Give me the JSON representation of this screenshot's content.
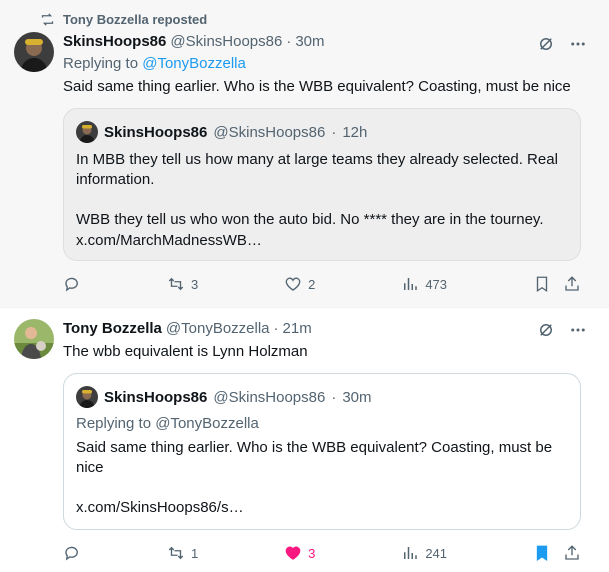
{
  "tweet1": {
    "repost_label": "Tony Bozzella reposted",
    "author_name": "SkinsHoops86",
    "author_handle": "@SkinsHoops86",
    "dot": "·",
    "time": "30m",
    "replying_prefix": "Replying to",
    "replying_mention": "@TonyBozzella",
    "text": "Said same thing earlier. Who is the WBB equivalent? Coasting, must be nice",
    "quote": {
      "author_name": "SkinsHoops86",
      "author_handle": "@SkinsHoops86",
      "dot": "·",
      "time": "12h",
      "text_line1": "In MBB they tell us how many at large teams they already selected. Real information.",
      "text_line2": "WBB they tell us who won the auto bid. No **** they are in the tourney.",
      "link": "x.com/MarchMadnessWB…"
    },
    "actions": {
      "reposts": "3",
      "likes": "2",
      "views": "473"
    }
  },
  "tweet2": {
    "author_name": "Tony Bozzella",
    "author_handle": "@TonyBozzella",
    "dot": "·",
    "time": "21m",
    "text": "The wbb equivalent is Lynn Holzman",
    "quote": {
      "author_name": "SkinsHoops86",
      "author_handle": "@SkinsHoops86",
      "dot": "·",
      "time": "30m",
      "replying_text": "Replying to @TonyBozzella",
      "text": "Said same thing earlier. Who is the WBB equivalent? Coasting, must be nice",
      "link": "x.com/SkinsHoops86/s…"
    },
    "actions": {
      "reposts": "1",
      "likes": "3",
      "views": "241"
    }
  },
  "colors": {
    "accent": "#1d9bf0",
    "like": "#f91880",
    "muted": "#536471"
  },
  "icons": [
    "repost-icon",
    "grok-icon",
    "more-icon",
    "reply-icon",
    "heart-icon",
    "views-icon",
    "bookmark-icon",
    "share-icon"
  ]
}
